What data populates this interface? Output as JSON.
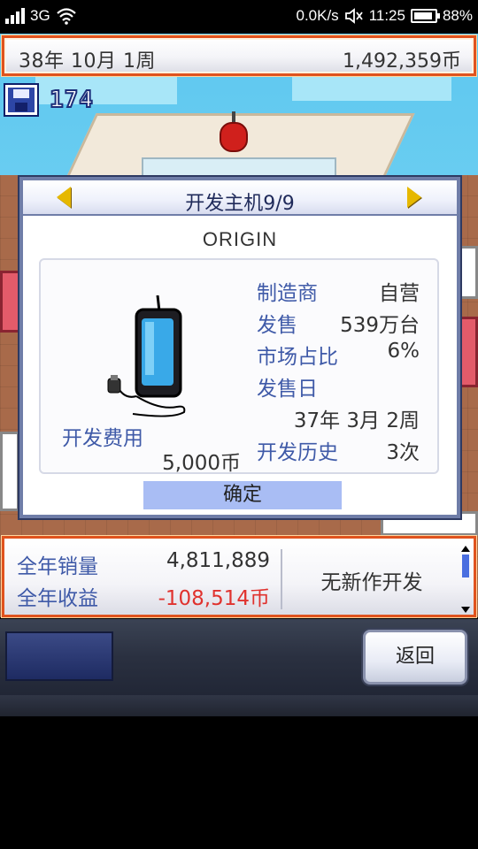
{
  "statusbar": {
    "network": "3G",
    "speed": "0.0K/s",
    "time": "11:25",
    "battery": "88%"
  },
  "topbar": {
    "date": "38年 10月 1周",
    "money": "1,492,359币"
  },
  "saves": {
    "count": "174"
  },
  "dialog": {
    "title": "开发主机9/9",
    "product_name": "ORIGIN",
    "labels": {
      "manufacturer": "制造商",
      "sales": "发售",
      "market_share": "市场占比",
      "release_date": "发售日",
      "dev_history": "开发历史",
      "dev_cost": "开发费用"
    },
    "values": {
      "manufacturer": "自营",
      "sales": "539万台",
      "market_share": "6%",
      "release_date": "37年 3月 2周",
      "dev_history": "3次",
      "dev_cost": "5,000币"
    },
    "ok_label": "确定"
  },
  "bottominfo": {
    "year_sales_label": "全年销量",
    "year_sales_value": "4,811,889",
    "year_profit_label": "全年收益",
    "year_profit_value": "-108,514币",
    "status_text": "无新作开发"
  },
  "controls": {
    "back_label": "返回"
  },
  "colors": {
    "accent_orange": "#e0531e",
    "label_blue": "#3f5aa8",
    "negative_red": "#e0322e",
    "ok_button": "#a9bdf4"
  }
}
